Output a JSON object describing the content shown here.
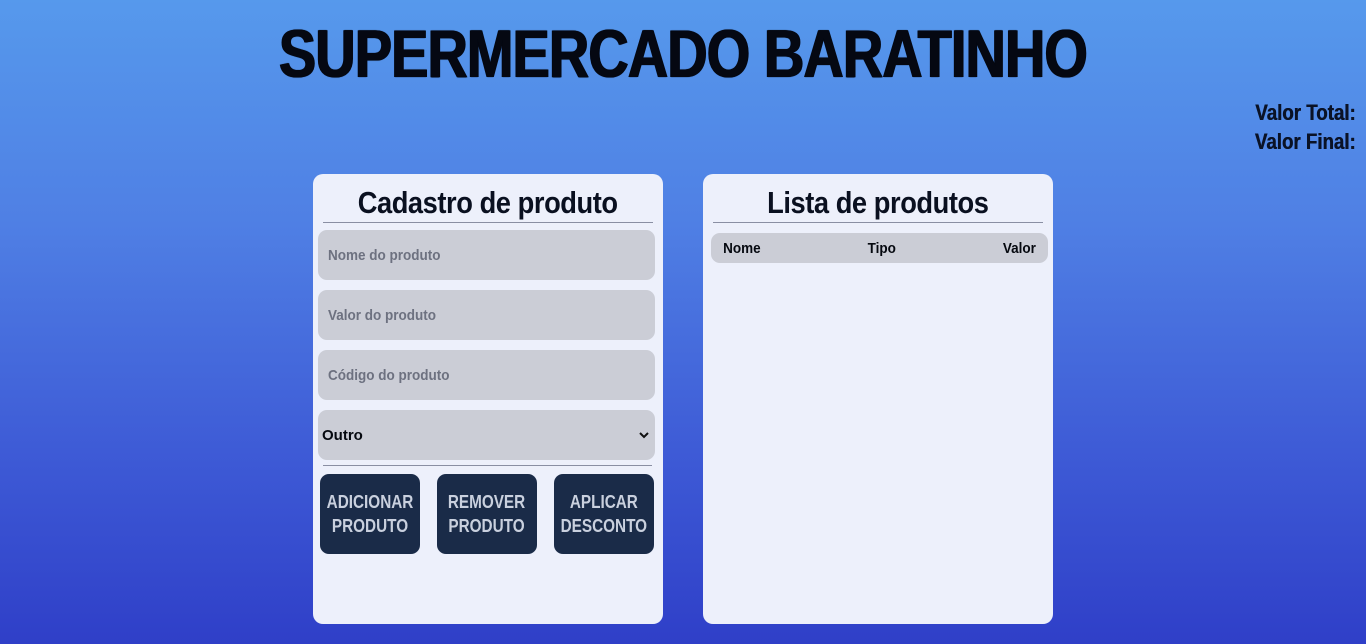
{
  "header": {
    "title": "SUPERMERCADO BARATINHO"
  },
  "totals": {
    "total_label": "Valor Total:",
    "final_label": "Valor Final:"
  },
  "form": {
    "title": "Cadastro de produto",
    "name_placeholder": "Nome do produto",
    "value_placeholder": "Valor do produto",
    "code_placeholder": "Código do produto",
    "type_selected": "Outro",
    "buttons": {
      "add": "ADICIONAR\nPRODUTO",
      "remove": "REMOVER\nPRODUTO",
      "discount": "APLICAR\nDESCONTO"
    }
  },
  "list": {
    "title": "Lista de produtos",
    "columns": [
      "Nome",
      "Tipo",
      "Valor"
    ],
    "rows": []
  },
  "colors": {
    "background_top": "#5699ec",
    "background_bottom": "#2f3fc8",
    "card": "#edf0fb",
    "field": "#cbcdd6",
    "button": "#1a2b48",
    "button_text": "#c9d0de"
  },
  "icons": {
    "select_arrow": "chevron-down-icon"
  }
}
